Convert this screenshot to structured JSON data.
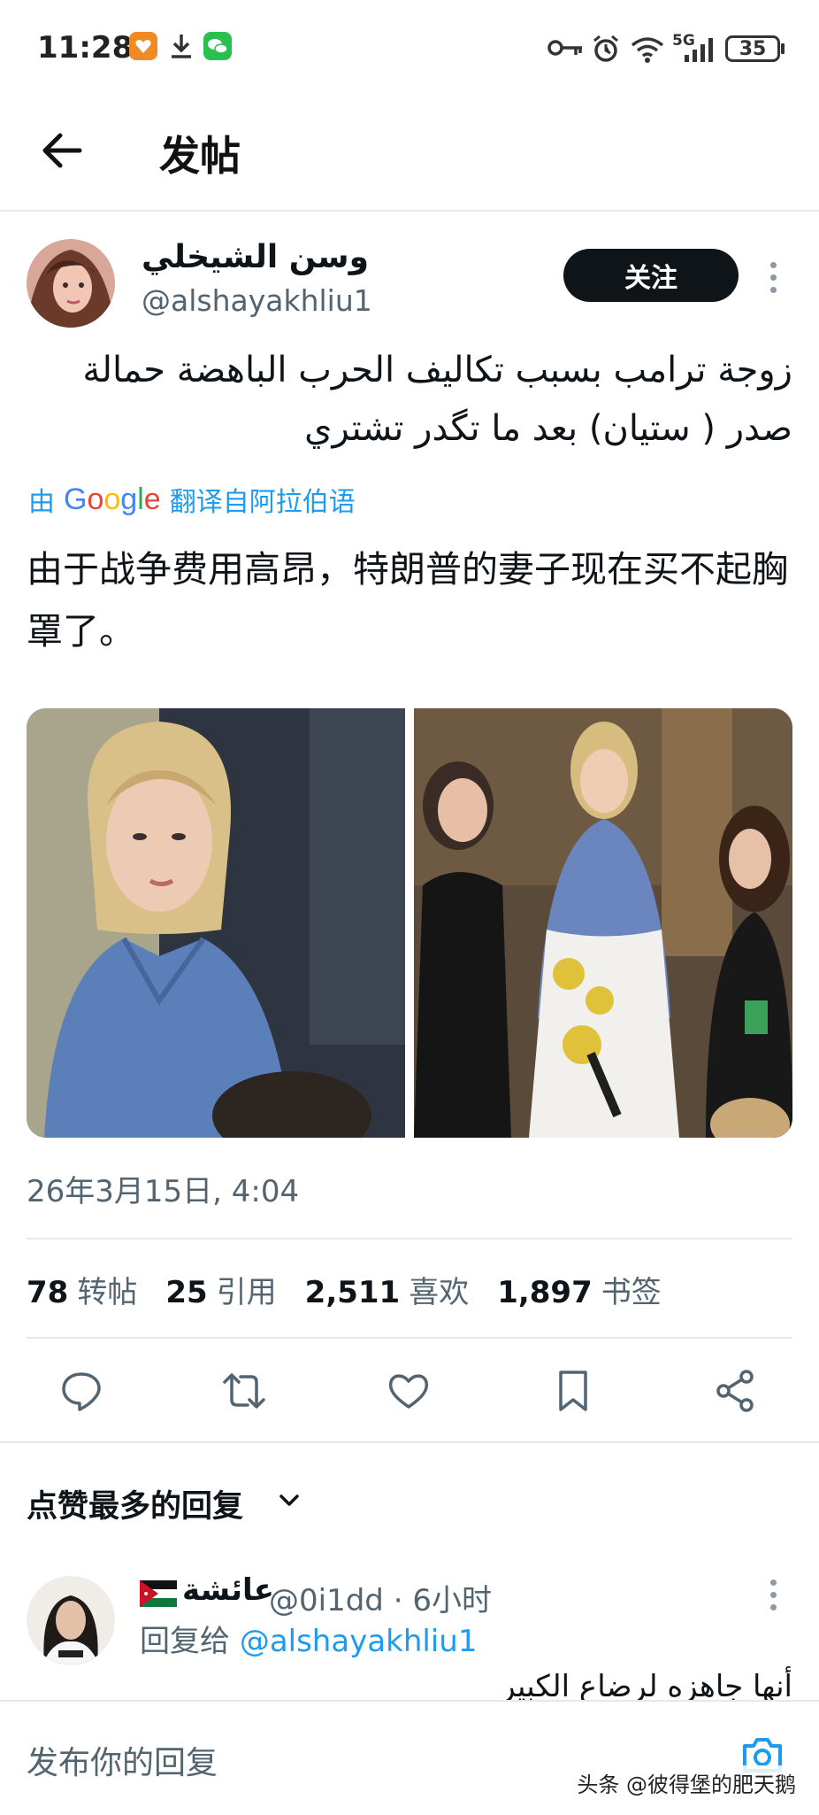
{
  "status_bar": {
    "time": "11:28",
    "battery": "35",
    "network": "5G"
  },
  "header": {
    "title": "发帖"
  },
  "post": {
    "author_name": "وسن الشيخلي",
    "author_handle": "@alshayakhliu1",
    "follow_label": "关注",
    "text_arabic": "زوجة ترامب بسبب تكاليف الحرب الباهضة حمالة\nصدر ( ستيان) بعد ما تگدر تشتري",
    "translate_prefix": "由",
    "translate_brand": "Google",
    "translate_suffix": "翻译自阿拉伯语",
    "text_translated": "由于战争费用高昂，特朗普的妻子现在买不起胸罩了。",
    "timestamp": "26年3月15日, 4:04",
    "stats": {
      "reposts_count": "78",
      "reposts_label": "转帖",
      "quotes_count": "25",
      "quotes_label": "引用",
      "likes_count": "2,511",
      "likes_label": "喜欢",
      "bookmarks_count": "1,897",
      "bookmarks_label": "书签"
    }
  },
  "replies": {
    "sort_label": "点赞最多的回复",
    "items": [
      {
        "name": "عائشة",
        "handle": "@0i1dd",
        "time": "6小时",
        "reply_to_prefix": "回复给",
        "reply_to_handle": "@alshayakhliu1",
        "text": "أنها جاهزه لرضاع الكبير"
      }
    ]
  },
  "composer": {
    "placeholder": "发布你的回复"
  },
  "watermark": "头条 @彼得堡的肥天鹅",
  "colors": {
    "accent": "#1d9bf0",
    "text_primary": "#0f1419",
    "text_secondary": "#536471",
    "follow_bg": "#0f1419"
  }
}
